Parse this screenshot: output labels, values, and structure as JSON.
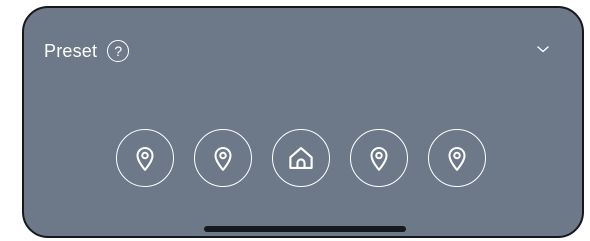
{
  "panel": {
    "title": "Preset",
    "help_symbol": "?",
    "help_icon": "help-circle-icon",
    "expand_icon": "chevron-down-icon"
  },
  "presets": [
    {
      "id": "preset-1",
      "icon": "location-pin-icon"
    },
    {
      "id": "preset-2",
      "icon": "location-pin-icon"
    },
    {
      "id": "home",
      "icon": "home-icon"
    },
    {
      "id": "preset-4",
      "icon": "location-pin-icon"
    },
    {
      "id": "preset-5",
      "icon": "location-pin-icon"
    }
  ],
  "colors": {
    "panel_background": "#6d7989",
    "foreground": "#ffffff",
    "frame_border": "#15181d"
  }
}
